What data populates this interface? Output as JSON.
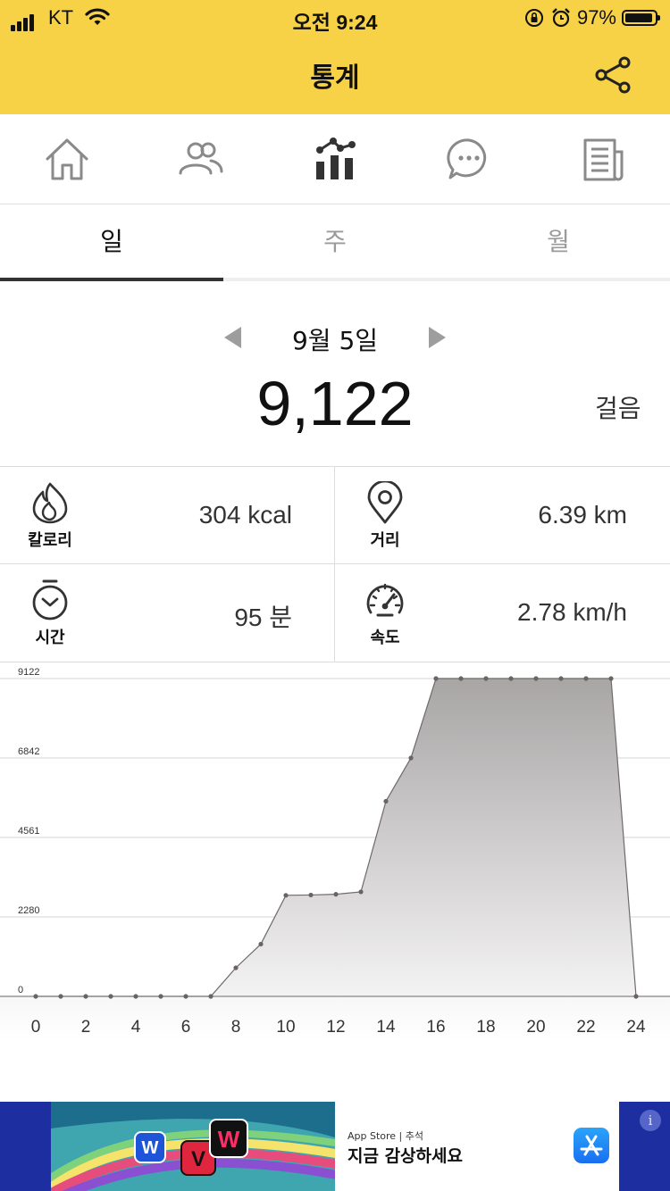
{
  "status_bar": {
    "carrier": "KT",
    "time": "오전 9:24",
    "battery_percent": "97%",
    "battery_level": 0.97
  },
  "header": {
    "title": "통계",
    "share_icon": "share-icon",
    "background": "#F7D146"
  },
  "nav": [
    {
      "name": "home",
      "icon": "home-icon"
    },
    {
      "name": "friends",
      "icon": "people-icon"
    },
    {
      "name": "stats",
      "icon": "chart-icon",
      "active": true
    },
    {
      "name": "chat",
      "icon": "chat-icon"
    },
    {
      "name": "news",
      "icon": "news-icon"
    }
  ],
  "tabs": [
    {
      "label": "일",
      "active": true
    },
    {
      "label": "주",
      "active": false
    },
    {
      "label": "월",
      "active": false
    }
  ],
  "summary": {
    "date": "9월 5일",
    "steps": "9,122",
    "steps_unit": "걸음"
  },
  "stats": {
    "calories": {
      "label": "칼로리",
      "value": "304 kcal",
      "icon": "flame-icon"
    },
    "distance": {
      "label": "거리",
      "value": "6.39 km",
      "icon": "location-pin-icon"
    },
    "time": {
      "label": "시간",
      "value": "95 분",
      "icon": "stopwatch-icon"
    },
    "speed": {
      "label": "속도",
      "value": "2.78 km/h",
      "icon": "speedometer-icon"
    }
  },
  "chart_data": {
    "type": "area",
    "x": [
      0,
      1,
      2,
      3,
      4,
      5,
      6,
      7,
      8,
      9,
      10,
      11,
      12,
      13,
      14,
      15,
      16,
      17,
      18,
      19,
      20,
      21,
      22,
      23,
      24
    ],
    "values": [
      0,
      0,
      0,
      0,
      0,
      0,
      0,
      0,
      820,
      1500,
      2900,
      2910,
      2930,
      3000,
      5600,
      6842,
      9122,
      9122,
      9122,
      9122,
      9122,
      9122,
      9122,
      9122,
      0
    ],
    "x_ticks": [
      "0",
      "2",
      "4",
      "6",
      "8",
      "10",
      "12",
      "14",
      "16",
      "18",
      "20",
      "22",
      "24"
    ],
    "y_ticks": [
      "0",
      "2280",
      "4561",
      "6842",
      "9122"
    ],
    "ylim": [
      0,
      9122
    ],
    "xlim": [
      0,
      24
    ],
    "grid": true
  },
  "ad": {
    "small_text": "App Store | 추석",
    "main_text": "지금 감상하세요",
    "info_label": "i"
  }
}
